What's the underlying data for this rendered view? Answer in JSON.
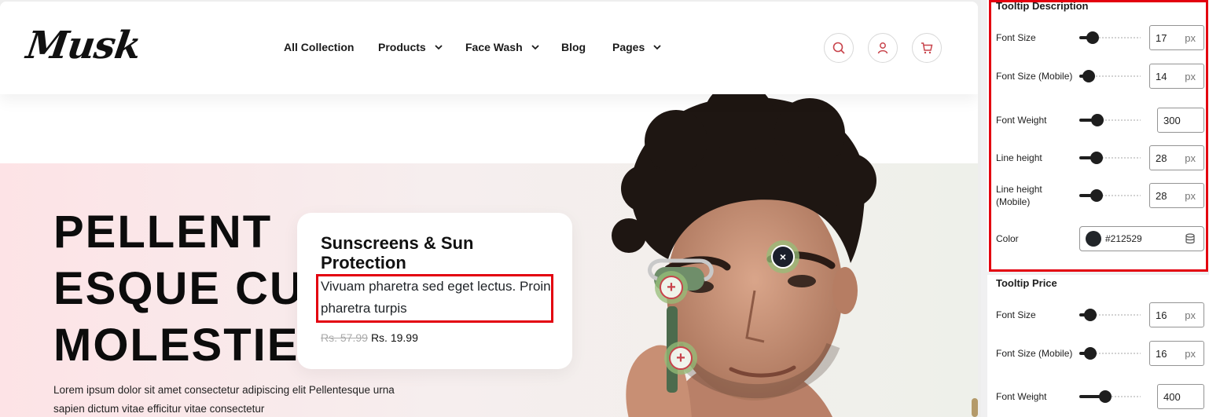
{
  "site": {
    "logo": "Musk",
    "nav": [
      {
        "label": "All Collection",
        "dropdown": false
      },
      {
        "label": "Products",
        "dropdown": true
      },
      {
        "label": "Face Wash",
        "dropdown": true
      },
      {
        "label": "Blog",
        "dropdown": false
      },
      {
        "label": "Pages",
        "dropdown": true
      }
    ],
    "header_icons": [
      "search-icon",
      "user-icon",
      "cart-icon"
    ],
    "hero": {
      "title": "PELLENT\nESQUE CU\nMOLESTIE",
      "text": "Lorem ipsum dolor sit amet consectetur adipiscing elit Pellentesque urna sapien dictum vitae efficitur vitae consectetur"
    },
    "tooltip": {
      "title": "Sunscreens & Sun Protection",
      "description": "Vivuam pharetra sed eget lectus. Proin pharetra turpis",
      "old_price": "Rs. 57.99",
      "new_price": "Rs. 19.99"
    },
    "hotspots": [
      {
        "symbol": "+",
        "state": "inactive"
      },
      {
        "symbol": "+",
        "state": "inactive"
      },
      {
        "symbol": "×",
        "state": "active"
      }
    ]
  },
  "panel": {
    "tooltip_description": {
      "title": "Tooltip Description",
      "font_size": {
        "label": "Font Size",
        "value": "17",
        "unit": "px",
        "level": 0.22
      },
      "font_size_mobile": {
        "label": "Font Size (Mobile)",
        "value": "14",
        "unit": "px",
        "level": 0.15
      },
      "font_weight": {
        "label": "Font Weight",
        "value": "300",
        "level": 0.3
      },
      "line_height": {
        "label": "Line height",
        "value": "28",
        "unit": "px",
        "level": 0.28
      },
      "line_height_mobile": {
        "label": "Line height (Mobile)",
        "value": "28",
        "unit": "px",
        "level": 0.28
      },
      "color": {
        "label": "Color",
        "value": "#212529"
      }
    },
    "tooltip_price": {
      "title": "Tooltip Price",
      "font_size": {
        "label": "Font Size",
        "value": "16",
        "unit": "px",
        "level": 0.18
      },
      "font_size_mobile": {
        "label": "Font Size (Mobile)",
        "value": "16",
        "unit": "px",
        "level": 0.18
      },
      "font_weight": {
        "label": "Font Weight",
        "value": "400",
        "level": 0.42
      }
    }
  },
  "colors": {
    "highlight": "#e3000f",
    "text_dark": "#212529",
    "icon_red": "#c8434b"
  }
}
